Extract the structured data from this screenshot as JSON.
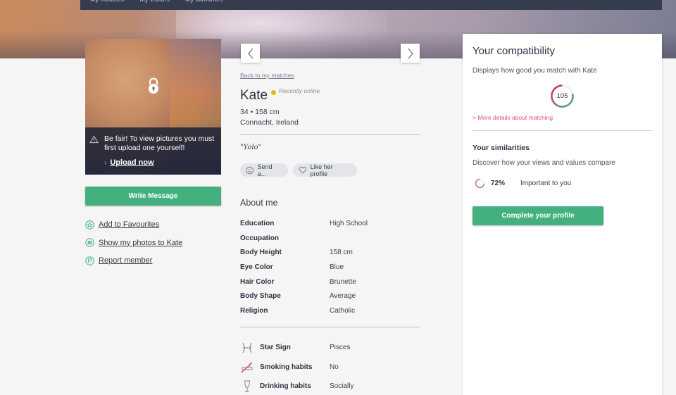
{
  "topnav": {
    "items": [
      "My matches",
      "My visitors",
      "My favourites"
    ]
  },
  "photo": {
    "locked": true,
    "notice": "Be fair! To view pictures you must first upload one yourself!",
    "upload_label": "Upload now",
    "icons": {
      "lock": "lock-icon",
      "warning": "warning-triangle-icon",
      "chevron": "chevron-right-icon"
    }
  },
  "actions": {
    "write_message": "Write Message",
    "links": [
      {
        "label": "Add to Favourites",
        "icon": "star-circle-icon"
      },
      {
        "label": "Show my photos to Kate",
        "icon": "photo-circle-icon"
      },
      {
        "label": "Report member",
        "icon": "flag-circle-icon"
      }
    ]
  },
  "profile": {
    "back_link": "Back to my matches",
    "name": "Kate",
    "status": "Recently online",
    "status_color": "#e6b518",
    "age_height": "34 • 158 cm",
    "location": "Connacht, Ireland",
    "quote": "\"Yolo\"",
    "send_label": "Send a...",
    "like_label": "Like her profile"
  },
  "about": {
    "title": "About me",
    "rows": [
      {
        "key": "Education",
        "value": "High School"
      },
      {
        "key": "Occupation",
        "value": ""
      },
      {
        "key": "Body Height",
        "value": "158 cm"
      },
      {
        "key": "Eye Color",
        "value": "Blue"
      },
      {
        "key": "Hair Color",
        "value": "Brunette"
      },
      {
        "key": "Body Shape",
        "value": "Average"
      },
      {
        "key": "Religion",
        "value": "Catholic"
      }
    ]
  },
  "lifestyle": {
    "rows": [
      {
        "key": "Star Sign",
        "value": "Pisces",
        "icon": "pisces-icon"
      },
      {
        "key": "Smoking habits",
        "value": "No",
        "icon": "no-smoking-icon"
      },
      {
        "key": "Drinking habits",
        "value": "Socially",
        "icon": "glass-icon"
      }
    ]
  },
  "compatibility": {
    "title": "Your compatibility",
    "description": "Displays how good you match with Kate",
    "score": "105",
    "score_fill": 0.78,
    "colors": {
      "start": "#3db07a",
      "end": "#ee2255"
    },
    "more_link": "> More details about matching",
    "similarities_title": "Your similarities",
    "similarities_desc": "Discover how your views and values compare",
    "similarity_percent": "72%",
    "similarity_fill": 0.72,
    "similarity_label": "Important to you",
    "complete_button": "Complete your profile"
  },
  "colors": {
    "accent_green": "#43b07e",
    "link_pink": "#e84a73",
    "nav_dark": "#343c4e"
  }
}
